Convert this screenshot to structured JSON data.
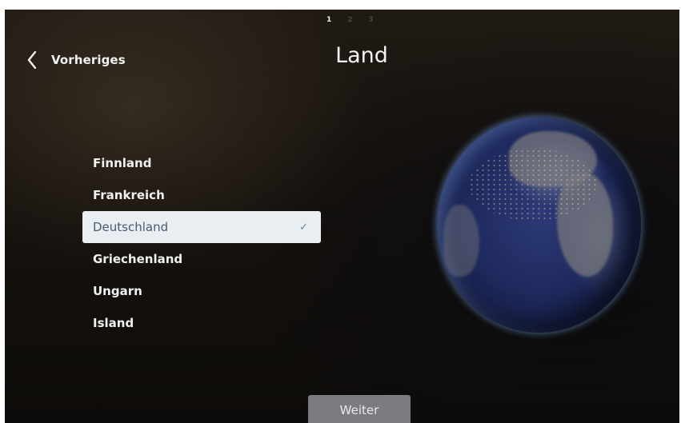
{
  "steps": [
    "1",
    "2",
    "3"
  ],
  "current_step": "1",
  "header": {
    "back_label": "Vorheriges",
    "title": "Land"
  },
  "countries": [
    {
      "label": "Finnland",
      "selected": false
    },
    {
      "label": "Frankreich",
      "selected": false
    },
    {
      "label": "Deutschland",
      "selected": true
    },
    {
      "label": "Griechenland",
      "selected": false
    },
    {
      "label": "Ungarn",
      "selected": false
    },
    {
      "label": "Island",
      "selected": false
    }
  ],
  "selected_check_icon": "check-icon",
  "footer": {
    "next_label": "Weiter"
  },
  "colors": {
    "selected_row_background": "#e9eef3",
    "selected_row_text": "#4a5a70",
    "next_button_background": "#7b7c80"
  },
  "icons": [
    "chevron-left-icon",
    "check-icon",
    "globe-image"
  ]
}
